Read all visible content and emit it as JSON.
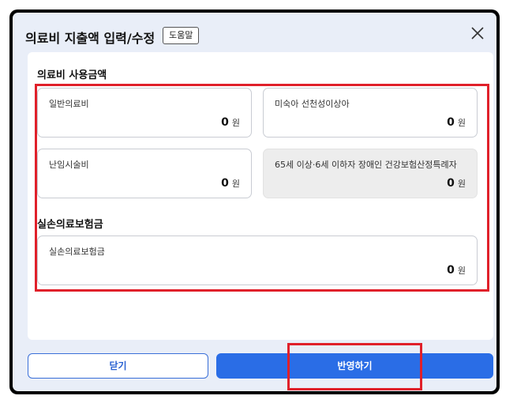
{
  "dialog": {
    "title": "의료비 지출액 입력/수정",
    "help_label": "도움말"
  },
  "medical": {
    "section_title": "의료비 사용금액",
    "general": {
      "label": "일반의료비",
      "amount": "0",
      "unit": "원"
    },
    "premature": {
      "label": "미숙아 선천성이상아",
      "amount": "0",
      "unit": "원"
    },
    "infertility": {
      "label": "난임시술비",
      "amount": "0",
      "unit": "원"
    },
    "senior": {
      "label": "65세 이상·6세 이하자 장애인 건강보험산정특례자",
      "amount": "0",
      "unit": "원"
    }
  },
  "insurance": {
    "section_title": "실손의료보험금",
    "card": {
      "label": "실손의료보험금",
      "amount": "0",
      "unit": "원"
    }
  },
  "footer": {
    "close_label": "닫기",
    "apply_label": "반영하기"
  },
  "colors": {
    "primary": "#2a6de6",
    "highlight": "#e0202a",
    "dialog_bg": "#e9eef8"
  }
}
